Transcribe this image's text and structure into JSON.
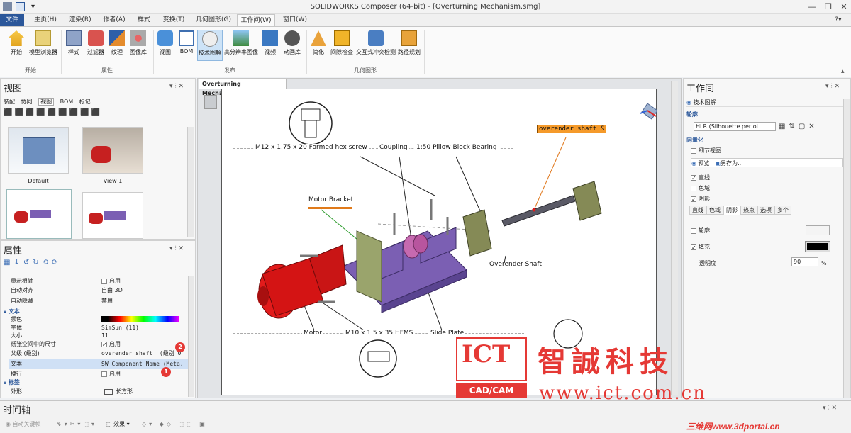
{
  "window": {
    "title": "SOLIDWORKS Composer (64-bit) - [Overturning Mechanism.smg]"
  },
  "ribbon_tabs": [
    "文件",
    "主页(H)",
    "渲染(R)",
    "作者(A)",
    "样式",
    "变换(T)",
    "几何图形(G)",
    "工作间(W)",
    "窗口(W)"
  ],
  "ribbon": {
    "buttons": [
      "开始",
      "模型浏览器",
      "样式",
      "过滤器",
      "纹理",
      "图像库",
      "视图",
      "BOM",
      "技术图解",
      "高分辨率图像",
      "视频",
      "动画库",
      "简化",
      "间隙检查",
      "交互式冲突检测",
      "路径规划"
    ],
    "groups": [
      "开始",
      "属性",
      "发布",
      "几何图形"
    ]
  },
  "views_panel": {
    "title": "视图",
    "tabs": [
      "装配",
      "协同",
      "视图",
      "BOM",
      "标记"
    ],
    "thumbs": [
      "Default",
      "View 1"
    ]
  },
  "props_panel": {
    "title": "属性",
    "rows": [
      {
        "name": "显示根轴",
        "value": "启用"
      },
      {
        "name": "自动对齐",
        "value": "自由 3D"
      },
      {
        "name": "自动隐藏",
        "value": "禁用"
      }
    ],
    "section_text": "文本",
    "color_label": "颜色",
    "font_label": "字体",
    "font_value": "SimSun (11)",
    "size_label": "大小",
    "size_value": "11",
    "paper_label": "纸张空间中的尺寸",
    "paper_value": "启用",
    "parent_label": "父级 (级别)",
    "parent_value": "overender shaft_ (级别 0",
    "text_label": "文本",
    "text_value": "SW Component Name (Meta.",
    "wrap_label": "换行",
    "wrap_value": "启用",
    "section_label": "标签",
    "shape_label": "外形",
    "shape_value": "长方形",
    "badge1": "1",
    "badge2": "2"
  },
  "document": {
    "tab": "Overturning Mechanism.smg",
    "labels": {
      "hex_screw": "M12 x 1.75 x 20 Formed hex screw",
      "coupling": "Coupling",
      "pillow": "1:50 Pillow Block Bearing",
      "motor_bracket": "Motor Bracket",
      "overender_shaft": "Overender Shaft",
      "overender_tag": "overender shaft &",
      "motor": "Motor",
      "hfms": "M10 x 1.5 x 35 HFMS",
      "slide_plate": "Slide Plate"
    }
  },
  "workspace": {
    "title": "工作间",
    "mode": "技术图解",
    "outline_section": "轮廓",
    "hlr_value": "HLR (Silhouette per ol",
    "vector_section": "向量化",
    "detail_view": "细节视图",
    "preview": "预览",
    "save_as": "另存为...",
    "lines": "直线",
    "color_fill": "色域",
    "shadow": "阴影",
    "tabs": [
      "直线",
      "色域",
      "阴影",
      "热点",
      "选项",
      "多个"
    ],
    "outline_label": "轮廓",
    "fill_label": "填充",
    "opacity_label": "透明度",
    "opacity_value": "90",
    "opacity_unit": "%"
  },
  "timeline": {
    "title": "时间轴",
    "auto_key": "自动关键帧",
    "effects": "效果"
  },
  "watermark": {
    "ict": "ICT",
    "cadcam": "CAD/CAM",
    "company": "智誠科技",
    "url": "www.ict.com.cn",
    "portal": "三维网www.3dportal.cn"
  },
  "colors": {
    "accent": "#2b579a",
    "motor": "#d41414",
    "plate": "#7b5fb3",
    "bracket": "#9aa46c",
    "tag": "#f28a1a"
  }
}
